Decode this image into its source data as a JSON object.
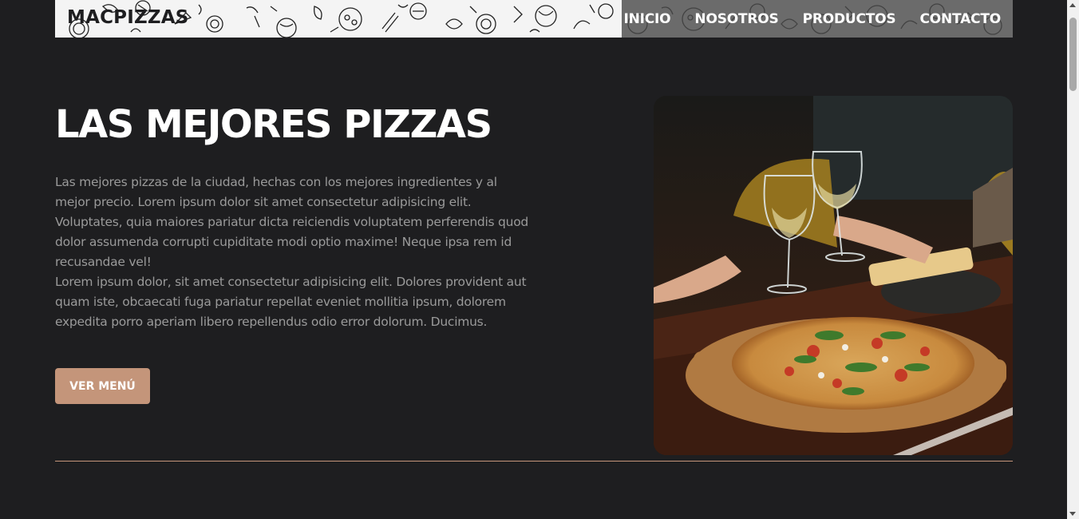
{
  "header": {
    "logo": "MACPIZZAS",
    "nav": [
      "INICIO",
      "NOSOTROS",
      "PRODUCTOS",
      "CONTACTO"
    ]
  },
  "hero": {
    "title": "LAS MEJORES PIZZAS",
    "paragraphs": [
      "Las mejores pizzas de la ciudad, hechas con los mejores ingredientes y al mejor precio. Lorem ipsum dolor sit amet consectetur adipisicing elit. Voluptates, quia maiores pariatur dicta reiciendis voluptatem perferendis quod dolor assumenda corrupti cupiditate modi optio maxime! Neque ipsa rem id recusandae vel!",
      "Lorem ipsum dolor, sit amet consectetur adipisicing elit. Dolores provident aut quam iste, obcaecati fuga pariatur repellat eveniet mollitia ipsum, dolorem expedita porro aperiam libero repellendus odio error dolorum. Ducimus."
    ],
    "button": "VER MENÚ",
    "image_icon": "pizza-and-wine-photo"
  },
  "colors": {
    "background": "#1e1e20",
    "accent": "#c4957a",
    "heading": "#ffffff",
    "body_text": "#9a9a9a",
    "nav_bg": "#6b6b6b"
  }
}
